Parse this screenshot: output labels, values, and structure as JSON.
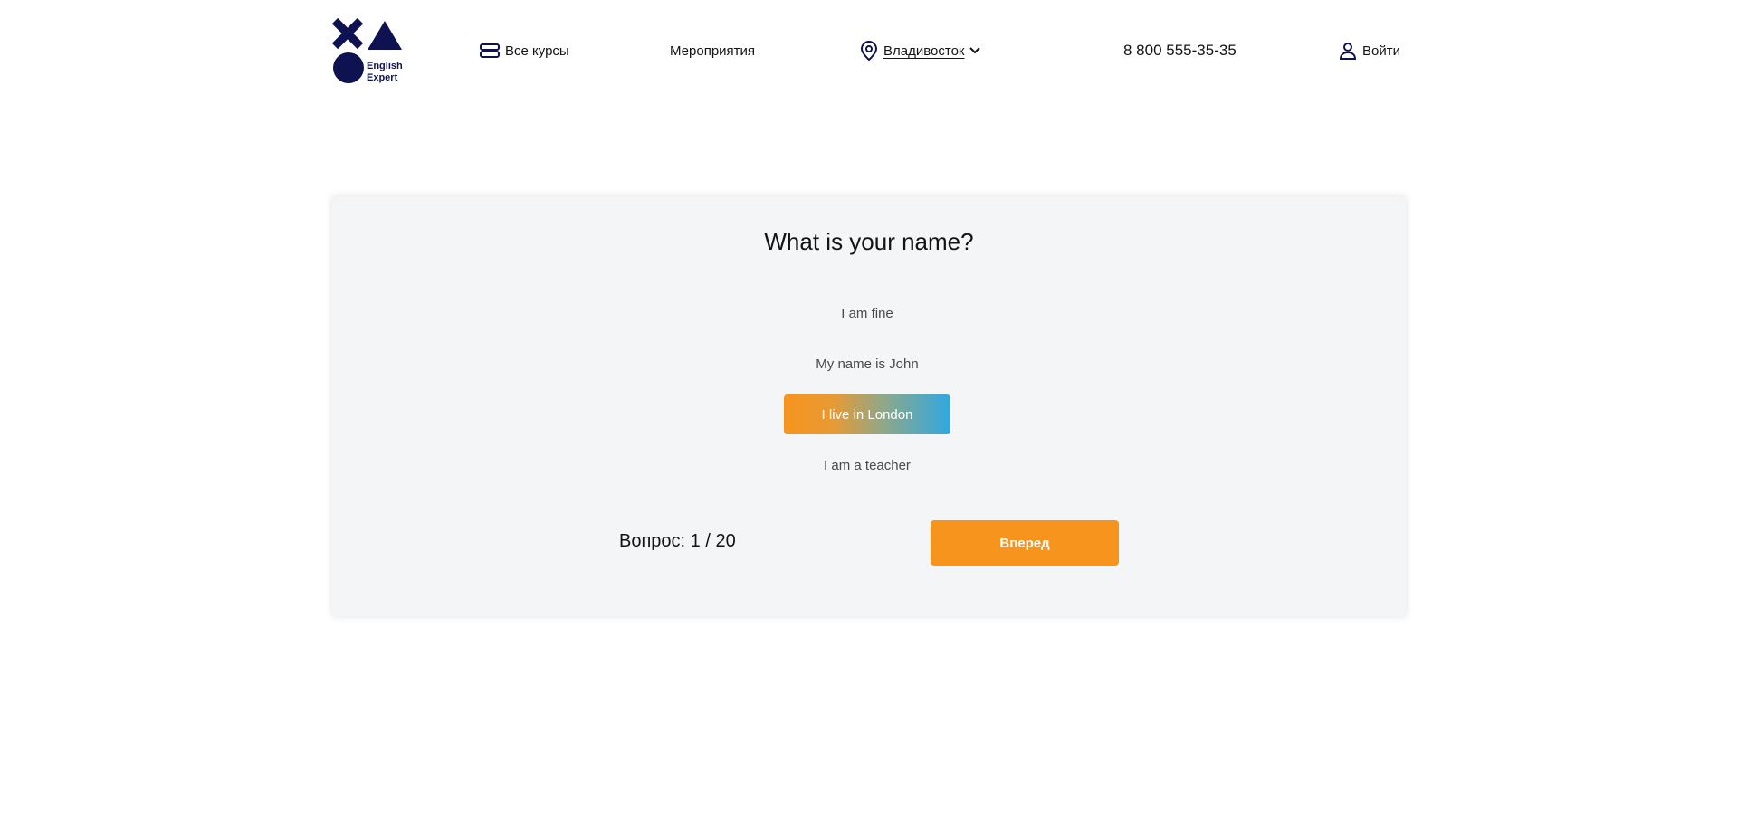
{
  "header": {
    "logo": {
      "text": "English\nExpert",
      "brand_color": "#0e1250"
    },
    "nav": {
      "courses": {
        "label": "Все курсы",
        "icon": "stack-icon"
      },
      "events": {
        "label": "Мероприятия"
      },
      "city": {
        "label": "Владивосток",
        "icon": "location-pin-icon",
        "dropdown_icon": "chevron-down-icon"
      },
      "phone": {
        "label": "8 800 555-35-35"
      },
      "login": {
        "label": "Войти",
        "icon": "user-icon"
      }
    }
  },
  "quiz": {
    "question": "What is your name?",
    "answers": [
      {
        "label": "I am fine",
        "selected": false
      },
      {
        "label": "My name is John",
        "selected": false
      },
      {
        "label": "I live in London",
        "selected": true
      },
      {
        "label": "I am a teacher",
        "selected": false
      }
    ],
    "counter": "Вопрос: 1 / 20",
    "next_label": "Вперед",
    "progress": {
      "current": 1,
      "total": 20
    }
  },
  "colors": {
    "accent": "#f7941e",
    "selected_gradient_end": "#30a8e0",
    "card_background": "#f4f5f7"
  }
}
